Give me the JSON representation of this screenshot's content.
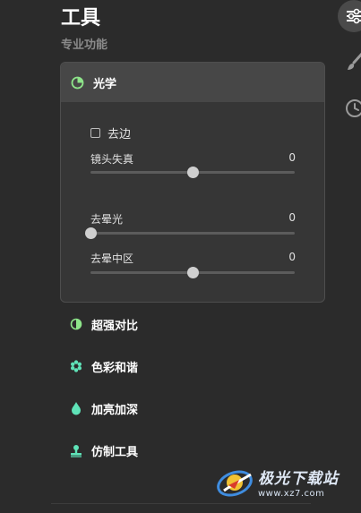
{
  "header": {
    "title": "工具",
    "subtitle": "专业功能"
  },
  "toolbar": {
    "items": [
      {
        "icon": "sliders-icon",
        "active": true
      },
      {
        "icon": "brush-icon",
        "active": false
      },
      {
        "icon": "clock-icon",
        "active": false
      }
    ]
  },
  "optics_panel": {
    "title": "光学",
    "icon": "lens-icon",
    "accent": "#8ee58a",
    "checkbox": {
      "label": "去边",
      "checked": false
    },
    "sliders": [
      {
        "label": "镜头失真",
        "value": "0",
        "position": 0.5
      },
      {
        "label": "去晕光",
        "value": "0",
        "position": 0.0
      },
      {
        "label": "去晕中区",
        "value": "0",
        "position": 0.5
      }
    ]
  },
  "tools": [
    {
      "label": "超强对比",
      "icon": "contrast-icon"
    },
    {
      "label": "色彩和谐",
      "icon": "flower-icon"
    },
    {
      "label": "加亮加深",
      "icon": "drop-icon"
    },
    {
      "label": "仿制工具",
      "icon": "stamp-icon"
    }
  ],
  "colors": {
    "accent_green": "#8ee58a",
    "tool_icon_teal": "#5fe3b8",
    "background": "#2b2b2b"
  },
  "watermark": {
    "brand": "极光下载站",
    "url": "www.xz7.com"
  }
}
